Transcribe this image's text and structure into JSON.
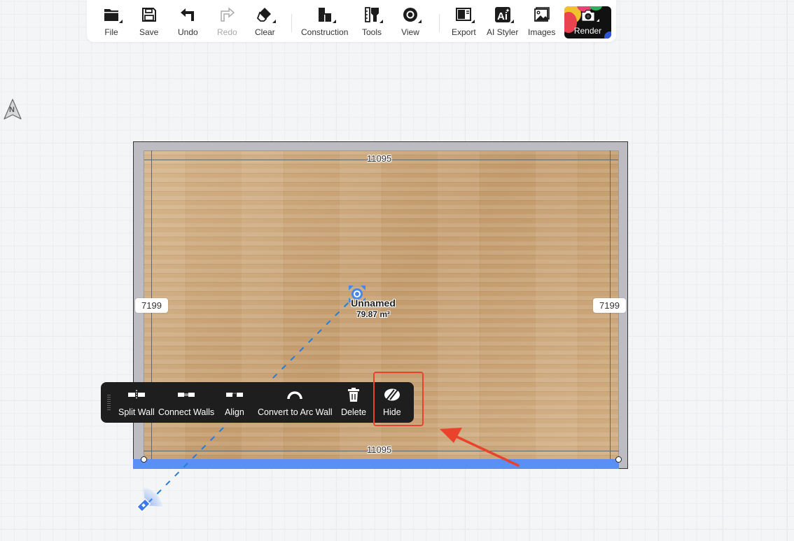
{
  "toolbar": {
    "items": [
      {
        "id": "file",
        "label": "File",
        "icon": "folder-icon",
        "has_menu": true,
        "enabled": true
      },
      {
        "id": "save",
        "label": "Save",
        "icon": "floppy-disk-icon",
        "has_menu": false,
        "enabled": true
      },
      {
        "id": "undo",
        "label": "Undo",
        "icon": "undo-arrow-icon",
        "has_menu": false,
        "enabled": true
      },
      {
        "id": "redo",
        "label": "Redo",
        "icon": "redo-arrow-icon",
        "has_menu": false,
        "enabled": false
      },
      {
        "id": "clear",
        "label": "Clear",
        "icon": "eraser-icon",
        "has_menu": true,
        "enabled": true
      },
      {
        "id": "construction",
        "label": "Construction",
        "icon": "blocks-icon",
        "has_menu": true,
        "enabled": true
      },
      {
        "id": "tools",
        "label": "Tools",
        "icon": "paint-brush-icon",
        "has_menu": true,
        "enabled": true
      },
      {
        "id": "view",
        "label": "View",
        "icon": "eye-icon",
        "has_menu": true,
        "enabled": true
      },
      {
        "id": "export",
        "label": "Export",
        "icon": "export-layout-icon",
        "has_menu": true,
        "enabled": true
      },
      {
        "id": "ai_styler",
        "label": "AI Styler",
        "icon": "ai-icon",
        "has_menu": true,
        "enabled": true
      },
      {
        "id": "images",
        "label": "Images",
        "icon": "image-icon",
        "has_menu": false,
        "enabled": true
      }
    ],
    "render": {
      "label": "Render",
      "icon": "camera-icon",
      "has_menu": true
    }
  },
  "compass": {
    "label": "N"
  },
  "room": {
    "name": "Unnamed",
    "area": "79.87 m²",
    "dimensions": {
      "top": "11095",
      "bottom": "11095",
      "left": "7199",
      "right": "7199"
    },
    "selected_wall": "bottom",
    "selection_color": "#5b8ff5"
  },
  "context_toolbar": {
    "items": [
      {
        "id": "split_wall",
        "label": "Split Wall",
        "icon": "split-wall-icon"
      },
      {
        "id": "connect_walls",
        "label": "Connect Walls",
        "icon": "connect-walls-icon"
      },
      {
        "id": "align",
        "label": "Align",
        "icon": "align-icon"
      },
      {
        "id": "convert_arc",
        "label": "Convert to Arc Wall",
        "icon": "arc-icon"
      },
      {
        "id": "delete",
        "label": "Delete",
        "icon": "trash-icon"
      },
      {
        "id": "hide",
        "label": "Hide",
        "icon": "eye-slash-icon"
      }
    ],
    "highlighted": "hide"
  },
  "annotation": {
    "color": "#e9432c"
  }
}
